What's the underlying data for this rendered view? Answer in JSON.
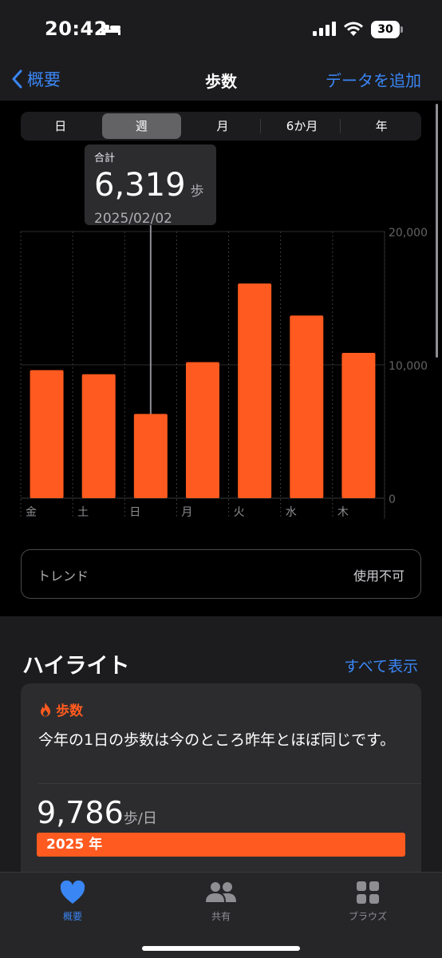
{
  "status": {
    "time": "20:42",
    "battery": "30"
  },
  "nav": {
    "back_label": "概要",
    "title": "歩数",
    "action_label": "データを追加"
  },
  "segments": [
    {
      "label": "日",
      "active": false
    },
    {
      "label": "週",
      "active": true
    },
    {
      "label": "月",
      "active": false
    },
    {
      "label": "6か月",
      "active": false
    },
    {
      "label": "年",
      "active": false
    }
  ],
  "callout": {
    "label": "合計",
    "value": "6,319",
    "unit": "歩",
    "date": "2025/02/02"
  },
  "chart_data": {
    "type": "bar",
    "categories": [
      "金",
      "土",
      "日",
      "月",
      "火",
      "水",
      "木"
    ],
    "values": [
      9600,
      9300,
      6319,
      10200,
      16100,
      13700,
      10900
    ],
    "ylim": [
      0,
      20000
    ],
    "yticks": [
      "0",
      "10,000",
      "20,000"
    ],
    "selected_index": 2,
    "bar_color": "#ff5a1f",
    "grid": true
  },
  "trend": {
    "label": "トレンド",
    "value": "使用不可"
  },
  "highlights": {
    "title": "ハイライト",
    "show_all": "すべて表示",
    "card": {
      "category": "歩数",
      "text": "今年の1日の歩数は今のところ昨年とほぼ同じです。",
      "value": "9,786",
      "unit": "歩/日",
      "year_label": "2025 年"
    }
  },
  "tabs": [
    {
      "label": "概要",
      "icon": "heart-icon",
      "active": true
    },
    {
      "label": "共有",
      "icon": "people-icon",
      "active": false
    },
    {
      "label": "ブラウズ",
      "icon": "grid-icon",
      "active": false
    }
  ],
  "colors": {
    "accent": "#3a86f5",
    "orange": "#ff5a1f",
    "background": "#000000"
  }
}
